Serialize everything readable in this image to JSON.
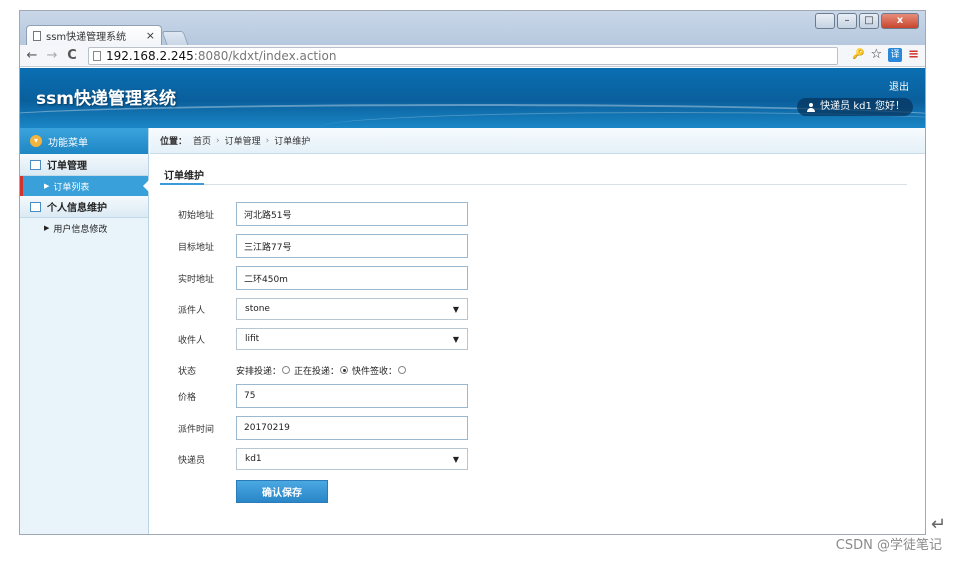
{
  "browser": {
    "tab_title": "ssm快递管理系统",
    "tab_close": "×",
    "url_host": "192.168.2.245",
    "url_path": ":8080/kdxt/index.action",
    "back": "←",
    "forward": "→",
    "reload": "C",
    "key_icon": "🔑",
    "star": "☆",
    "ext_label": "译",
    "menu": "≡",
    "win_min": "–",
    "win_max": "□",
    "win_close": "x"
  },
  "header": {
    "title": "ssm快递管理系统",
    "logout": "退出",
    "user_greeting": "快递员 kd1 您好！"
  },
  "sidebar": {
    "heading": "功能菜单",
    "groups": [
      {
        "label": "订单管理",
        "items": [
          {
            "label": "订单列表",
            "active": true
          }
        ]
      },
      {
        "label": "个人信息维护",
        "items": [
          {
            "label": "用户信息修改",
            "active": false
          }
        ]
      }
    ]
  },
  "breadcrumb": {
    "label": "位置：",
    "items": [
      "首页",
      "订单管理",
      "订单维护"
    ]
  },
  "form": {
    "section_title": "订单维护",
    "start_address": {
      "label": "初始地址",
      "value": "河北路51号"
    },
    "target_address": {
      "label": "目标地址",
      "value": "三江路77号"
    },
    "current_address": {
      "label": "实时地址",
      "value": "二环450m"
    },
    "sender": {
      "label": "派件人",
      "value": "stone"
    },
    "receiver": {
      "label": "收件人",
      "value": "lifit"
    },
    "status": {
      "label": "状态",
      "options": [
        {
          "label": "安排投递：",
          "checked": false
        },
        {
          "label": "正在投递：",
          "checked": true
        },
        {
          "label": "快件签收：",
          "checked": false
        }
      ]
    },
    "price": {
      "label": "价格",
      "value": "75"
    },
    "dispatch_time": {
      "label": "派件时间",
      "value": "20170219"
    },
    "courier": {
      "label": "快递员",
      "value": "kd1"
    },
    "submit_label": "确认保存"
  },
  "watermark": "CSDN @学徒笔记",
  "return_glyph": "↵"
}
